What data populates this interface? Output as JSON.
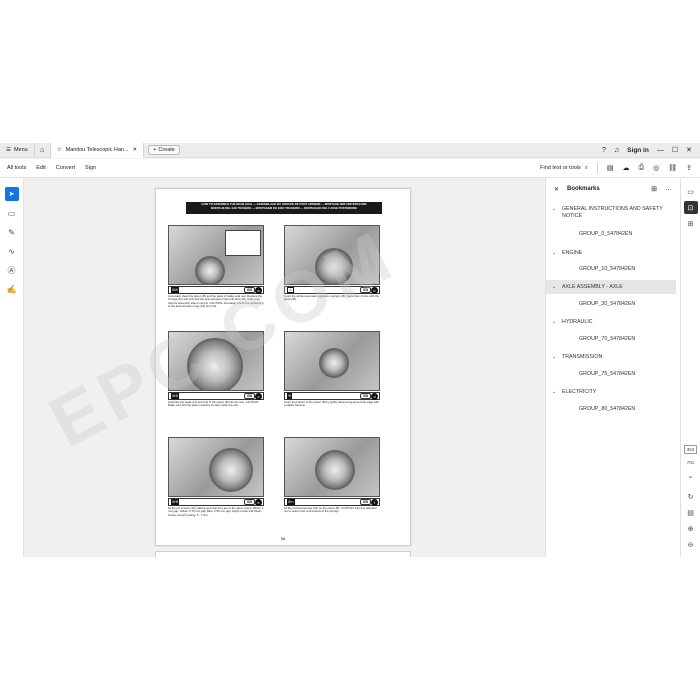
{
  "tabbar": {
    "menu_label": "Menu",
    "tab_title": "Manitou Telescopic Han...",
    "create_label": "Create",
    "signin_label": "Sign in"
  },
  "toolbar": {
    "menu": [
      "All tools",
      "Edit",
      "Convert",
      "Sign"
    ],
    "find_label": "Find text or tools"
  },
  "document": {
    "page_title_lines": [
      "HOW TO ASSEMBLE THE REAR AXLE — ASSEMBLAGE DU GROUPE DE PONT ARRIERE — MONTAGE DER HINTERACHSE",
      "MONTAJE DEL EJE TRASERO — MONTAGEM DO EIXO TRASEIRO — MONTAGGIO DELL'ASSE POSTERIORE"
    ],
    "panels": [
      {
        "letter": "a",
        "gb": "GB",
        "caption": "Accurately clean the piston (B) and the parts of holder and reel. Replace the O-rings (11) and (12) and the anti-extrusion rings (13) and (14); make sure that the assembly side is correct. CAUTION: Accurately check the positioning of the anti-extrusion rings (13) and (14)."
      },
      {
        "letter": "b",
        "gb": "GB",
        "caption": "Insert the whole automatic regulation springs (15); place them in line with the piston (B)."
      },
      {
        "letter": "c",
        "gb": "GB",
        "caption": "Lubricate the seals (11) and (12) fit the piston (B) into the arm. CAUTION: Make sure that the piston reaches its stop inside the arm."
      },
      {
        "letter": "d",
        "gb": "GB",
        "caption": "Insert the bottom of the piston (B) by lightly hammering around the edge with a plastic hammer."
      },
      {
        "letter": "e",
        "gb": "GB",
        "caption": "Fit the pin screws (15) making sure that they are of the same colour. White: 1 mm gap; Yellow: 0.75 mm gap; Blue: 0.50 mm gap. Apply Loctite 242 (blue). Torque wrench setting: 5 - 7 Nm."
      },
      {
        "letter": "f",
        "gb": "GB",
        "caption": "Fit the reversal springs (16) on the piston (B). CAUTION: Pay due attention not to deform the connections of the springs."
      }
    ],
    "page_number": "58",
    "watermark": "EPC.COM"
  },
  "bookmarks": {
    "title": "Bookmarks",
    "items": [
      {
        "label": "GENERAL INSTRUCTIONS AND SAFETY NOTICE",
        "child": "GROUP_0_547842EN"
      },
      {
        "label": "ENGINE",
        "child": "GROUP_10_547842EN"
      },
      {
        "label": "AXLE ASSEMBLY - AXLE",
        "child": "GROUP_30_547842EN"
      },
      {
        "label": "HYDRAULIC",
        "child": "GROUP_70_547842EN"
      },
      {
        "label": "TRANSMISSION",
        "child": "GROUP_75_547842EN"
      },
      {
        "label": "ELECTRICITY",
        "child": "GROUP_80_547842EN"
      }
    ]
  },
  "rightrail": {
    "current_page": "353",
    "total_pages": "701"
  },
  "colors": {
    "accent": "#1473e6",
    "active_bookmark": "#e6e6e6"
  }
}
